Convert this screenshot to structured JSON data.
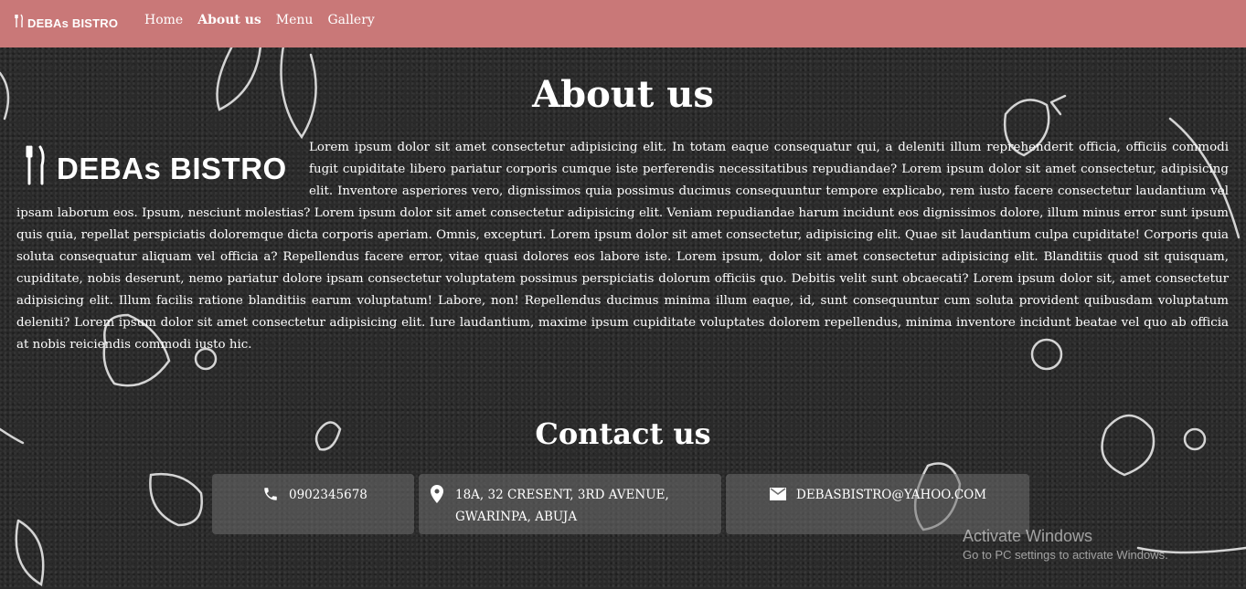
{
  "nav": {
    "brand": "DEBAs BISTRO",
    "links": [
      "Home",
      "About us",
      "Menu",
      "Gallery"
    ]
  },
  "about": {
    "title": "About us",
    "logo_text": "DEBAs BISTRO",
    "body": "Lorem ipsum dolor sit amet consectetur adipisicing elit. In totam eaque consequatur qui, a deleniti illum reprehenderit officia, officiis commodi fugit cupiditate libero pariatur corporis cumque iste perferendis necessitatibus repudiandae? Lorem ipsum dolor sit amet consectetur, adipisicing elit. Inventore asperiores vero, dignissimos quia possimus ducimus consequuntur tempore explicabo, rem iusto facere consectetur laudantium vel ipsam laborum eos. Ipsum, nesciunt molestias? Lorem ipsum dolor sit amet consectetur adipisicing elit. Veniam repudiandae harum incidunt eos dignissimos dolore, illum minus error sunt ipsum quis quia, repellat perspiciatis doloremque dicta corporis aperiam. Omnis, excepturi. Lorem ipsum dolor sit amet consectetur, adipisicing elit. Quae sit laudantium culpa cupiditate! Corporis quia soluta consequatur aliquam vel officia a? Repellendus facere error, vitae quasi dolores eos labore iste. Lorem ipsum, dolor sit amet consectetur adipisicing elit. Blanditiis quod sit quisquam, cupiditate, nobis deserunt, nemo pariatur dolore ipsam consectetur voluptatem possimus perspiciatis dolorum officiis quo. Debitis velit sunt obcaecati? Lorem ipsum dolor sit, amet consectetur adipisicing elit. Illum facilis ratione blanditiis earum voluptatum! Labore, non! Repellendus ducimus minima illum eaque, id, sunt consequuntur cum soluta provident quibusdam voluptatum deleniti? Lorem ipsum dolor sit amet consectetur adipisicing elit. Iure laudantium, maxime ipsum cupiditate voluptates dolorem repellendus, minima inventore incidunt beatae vel quo ab officia at nobis reiciendis commodi iusto hic."
  },
  "contact": {
    "title": "Contact us",
    "phone": "0902345678",
    "address_line1": "18A, 32 CRESENT, 3RD AVENUE,",
    "address_line2": "GWARINPA, ABUJA",
    "email": "DEBASBISTRO@YAHOO.COM"
  },
  "icons": {
    "brand": "fork-knife-icon",
    "phone": "phone-icon",
    "address": "map-pin-icon",
    "email": "envelope-icon"
  },
  "watermark": {
    "line1": "Activate Windows",
    "line2": "Go to PC settings to activate Windows."
  },
  "colors": {
    "navbar": "#c97878",
    "background": "#2a2a2a",
    "card": "#6e6e6e"
  }
}
